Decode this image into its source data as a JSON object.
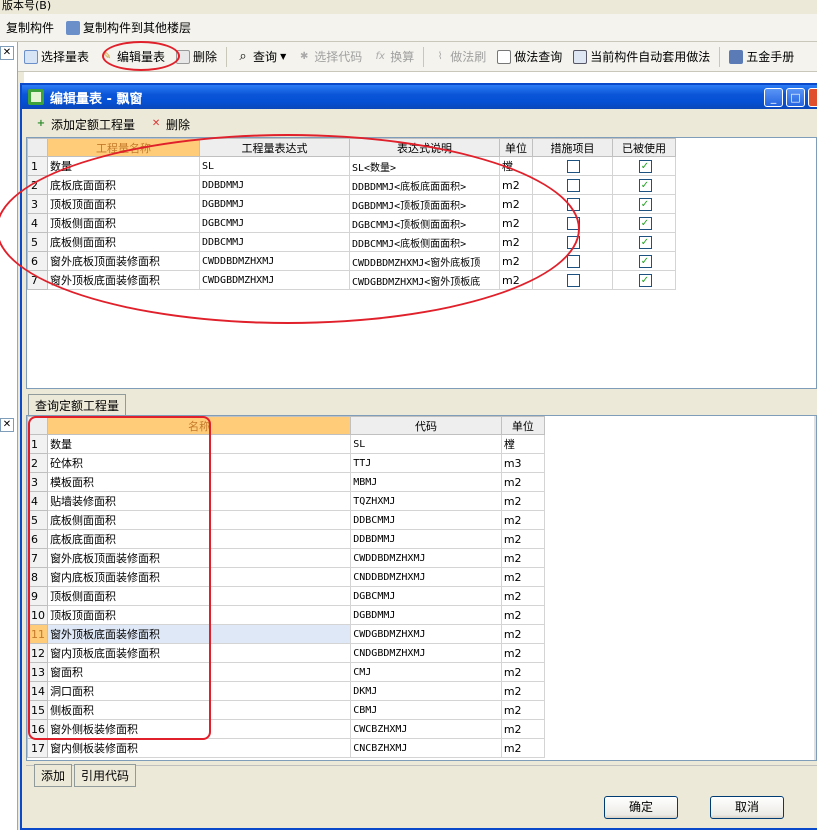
{
  "menubar": {
    "text": "版本号(B)"
  },
  "toolbar1": {
    "copy_component": "复制构件",
    "copy_to_floor": "复制构件到其他楼层"
  },
  "toolbar2": {
    "select_table": "选择量表",
    "edit_table": "编辑量表",
    "delete": "删除",
    "query": "查询",
    "select_code": "选择代码",
    "convert": "换算",
    "method_brush": "做法刷",
    "method_query": "做法查询",
    "auto_apply": "当前构件自动套用做法",
    "hardware_manual": "五金手册"
  },
  "dialog": {
    "title": "编辑量表 - 飘窗",
    "add_quota": "添加定额工程量",
    "delete": "删除",
    "ok": "确定",
    "cancel": "取消"
  },
  "upper_table": {
    "headers": [
      "工程量名称",
      "工程量表达式",
      "表达式说明",
      "单位",
      "措施项目",
      "已被使用"
    ],
    "rows": [
      {
        "no": "1",
        "name": "数量",
        "expr": "SL",
        "desc": "SL<数量>",
        "unit": "樘",
        "measure": false,
        "used": true
      },
      {
        "no": "2",
        "name": "底板底面面积",
        "expr": "DDBDMMJ",
        "desc": "DDBDMMJ<底板底面面积>",
        "unit": "m2",
        "measure": false,
        "used": true
      },
      {
        "no": "3",
        "name": "顶板顶面面积",
        "expr": "DGBDMMJ",
        "desc": "DGBDMMJ<顶板顶面面积>",
        "unit": "m2",
        "measure": false,
        "used": true
      },
      {
        "no": "4",
        "name": "顶板侧面面积",
        "expr": "DGBCMMJ",
        "desc": "DGBCMMJ<顶板侧面面积>",
        "unit": "m2",
        "measure": false,
        "used": true
      },
      {
        "no": "5",
        "name": "底板侧面面积",
        "expr": "DDBCMMJ",
        "desc": "DDBCMMJ<底板侧面面积>",
        "unit": "m2",
        "measure": false,
        "used": true
      },
      {
        "no": "6",
        "name": "窗外底板顶面装修面积",
        "expr": "CWDDBDMZHXMJ",
        "desc": "CWDDBDMZHXMJ<窗外底板顶",
        "unit": "m2",
        "measure": false,
        "used": true
      },
      {
        "no": "7",
        "name": "窗外顶板底面装修面积",
        "expr": "CWDGBDMZHXMJ",
        "desc": "CWDGBDMZHXMJ<窗外顶板底",
        "unit": "m2",
        "measure": false,
        "used": true
      }
    ]
  },
  "lower_tab": "查询定额工程量",
  "lower_table": {
    "headers": [
      "名称",
      "代码",
      "单位"
    ],
    "rows": [
      {
        "no": "1",
        "name": "数量",
        "code": "SL",
        "unit": "樘"
      },
      {
        "no": "2",
        "name": "砼体积",
        "code": "TTJ",
        "unit": "m3"
      },
      {
        "no": "3",
        "name": "模板面积",
        "code": "MBMJ",
        "unit": "m2"
      },
      {
        "no": "4",
        "name": "贴墙装修面积",
        "code": "TQZHXMJ",
        "unit": "m2"
      },
      {
        "no": "5",
        "name": "底板侧面面积",
        "code": "DDBCMMJ",
        "unit": "m2"
      },
      {
        "no": "6",
        "name": "底板底面面积",
        "code": "DDBDMMJ",
        "unit": "m2"
      },
      {
        "no": "7",
        "name": "窗外底板顶面装修面积",
        "code": "CWDDBDMZHXMJ",
        "unit": "m2"
      },
      {
        "no": "8",
        "name": "窗内底板顶面装修面积",
        "code": "CNDDBDMZHXMJ",
        "unit": "m2"
      },
      {
        "no": "9",
        "name": "顶板侧面面积",
        "code": "DGBCMMJ",
        "unit": "m2"
      },
      {
        "no": "10",
        "name": "顶板顶面面积",
        "code": "DGBDMMJ",
        "unit": "m2"
      },
      {
        "no": "11",
        "name": "窗外顶板底面装修面积",
        "code": "CWDGBDMZHXMJ",
        "unit": "m2"
      },
      {
        "no": "12",
        "name": "窗内顶板底面装修面积",
        "code": "CNDGBDMZHXMJ",
        "unit": "m2"
      },
      {
        "no": "13",
        "name": "窗面积",
        "code": "CMJ",
        "unit": "m2"
      },
      {
        "no": "14",
        "name": "洞口面积",
        "code": "DKMJ",
        "unit": "m2"
      },
      {
        "no": "15",
        "name": "侧板面积",
        "code": "CBMJ",
        "unit": "m2"
      },
      {
        "no": "16",
        "name": "窗外侧板装修面积",
        "code": "CWCBZHXMJ",
        "unit": "m2"
      },
      {
        "no": "17",
        "name": "窗内侧板装修面积",
        "code": "CNCBZHXMJ",
        "unit": "m2"
      }
    ]
  },
  "bottom_tabs": {
    "add": "添加",
    "ref_code": "引用代码"
  },
  "colors": {
    "title_bar": "#0a55d8",
    "highlight": "#e0202a",
    "selected_header": "#ffcc7a"
  }
}
